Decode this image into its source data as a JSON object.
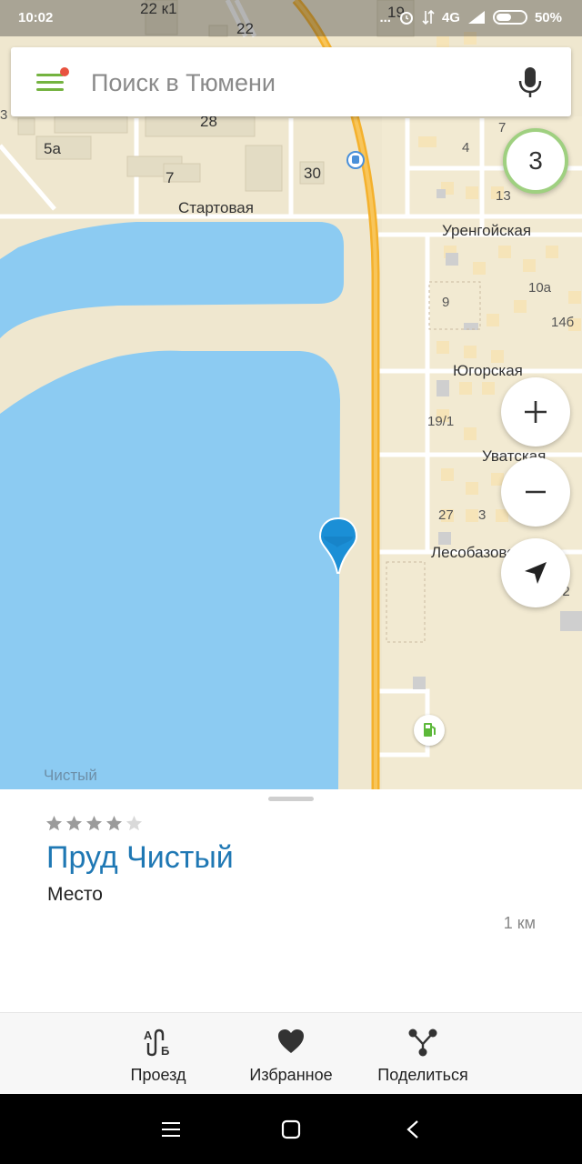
{
  "status_bar": {
    "time": "10:02",
    "network": "4G",
    "battery": "50%",
    "dots": "..."
  },
  "search": {
    "placeholder": "Поиск в Тюмени"
  },
  "map": {
    "cluster_count": "3",
    "street_labels": {
      "startovaya": "Стартовая",
      "urengoyskaya": "Уренгойская",
      "yugorskaya": "Югорская",
      "uvatskaya": "Уватская",
      "lesobazovskaya": "Лесобазовская"
    },
    "house_numbers": {
      "h22k1": "22 к1",
      "h22": "22",
      "h19": "19",
      "h28": "28",
      "h5a": "5а",
      "h7a": "7",
      "h30": "30",
      "h3": "3",
      "h7b": "7",
      "h4": "4",
      "h13": "13",
      "h10a": "10а",
      "h9": "9",
      "h14b": "14б",
      "h19_1": "19/1",
      "h27": "27",
      "h3b": "3",
      "h12": "12"
    },
    "water_label": "Чистый",
    "accent_colors": {
      "water": "#8ccbf2",
      "road": "#f4b12d",
      "ground": "#efe7cf",
      "pin": "#1b8fd6"
    }
  },
  "place_card": {
    "rating_filled": 4,
    "rating_max": 5,
    "title": "Пруд Чистый",
    "type": "Место",
    "distance": "1 км"
  },
  "actions": {
    "route": "Проезд",
    "favorites": "Избранное",
    "share": "Поделиться"
  }
}
